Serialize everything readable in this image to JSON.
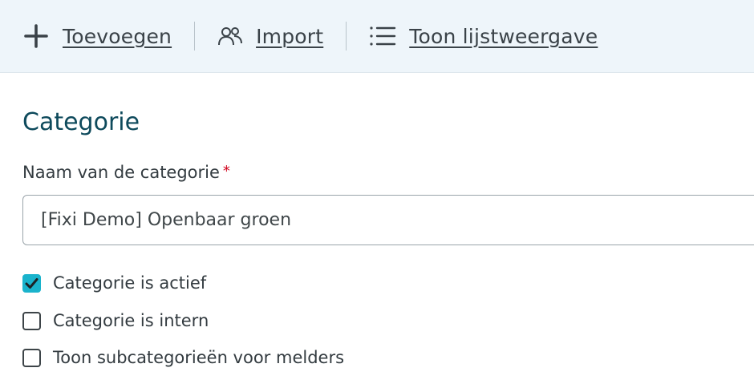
{
  "toolbar": {
    "add": {
      "label": "Toevoegen",
      "icon": "plus-icon"
    },
    "import": {
      "label": "Import",
      "icon": "users-icon"
    },
    "list_view": {
      "label": "Toon lijstweergave",
      "icon": "list-icon"
    }
  },
  "section": {
    "title": "Categorie"
  },
  "form": {
    "name_label": "Naam van de categorie",
    "required_marker": "*",
    "name_value": "[Fixi Demo] Openbaar groen",
    "checkboxes": [
      {
        "label": "Categorie is actief",
        "checked": true
      },
      {
        "label": "Categorie is intern",
        "checked": false
      },
      {
        "label": "Toon subcategorieën voor melders",
        "checked": false
      }
    ]
  },
  "colors": {
    "toolbar_bg": "#eef5fa",
    "title": "#0e4a5c",
    "checkbox_checked": "#1ab3cc",
    "required": "#d0021b"
  }
}
